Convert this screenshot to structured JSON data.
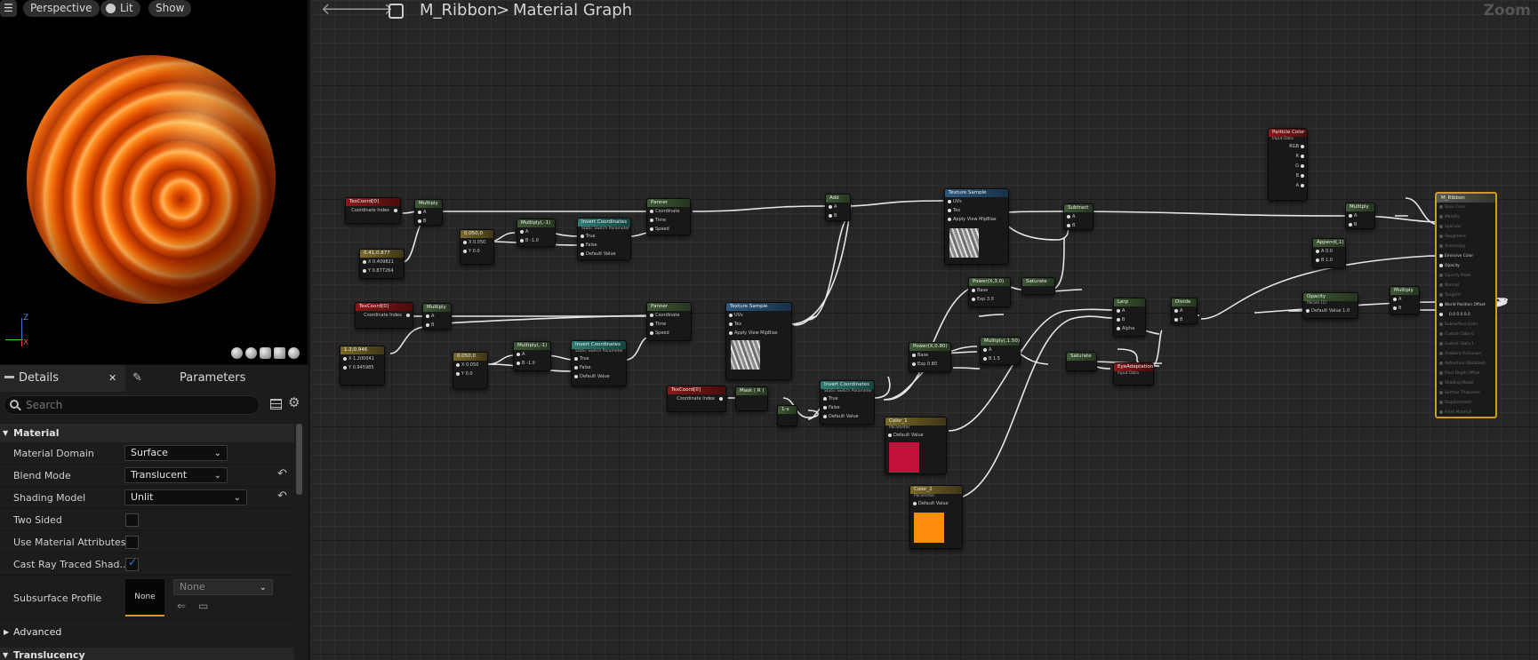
{
  "viewport": {
    "menu_label": "☰",
    "perspective_label": "Perspective",
    "lit_label": "Lit",
    "show_label": "Show",
    "axis_labels": {
      "x": "X",
      "z": "Z"
    }
  },
  "details": {
    "tab_details": "Details",
    "tab_parameters": "Parameters",
    "search_placeholder": "Search",
    "category_material": "Material",
    "rows": {
      "material_domain": {
        "label": "Material Domain",
        "value": "Surface"
      },
      "blend_mode": {
        "label": "Blend Mode",
        "value": "Translucent"
      },
      "shading_model": {
        "label": "Shading Model",
        "value": "Unlit"
      },
      "two_sided": {
        "label": "Two Sided",
        "checked": false
      },
      "use_material_attributes": {
        "label": "Use Material Attributes",
        "checked": false
      },
      "cast_ray_traced_shadows": {
        "label": "Cast Ray Traced Shad...",
        "checked": true
      },
      "subsurface_profile": {
        "label": "Subsurface Profile",
        "thumb": "None",
        "value": "None"
      }
    },
    "category_advanced": "Advanced",
    "category_translucency": "Translucency"
  },
  "graph": {
    "breadcrumb_asset": "M_Ribbon",
    "breadcrumb_sep": ">",
    "breadcrumb_page": "Material Graph",
    "zoom_label": "Zoom",
    "nodes": {
      "texcoord1": {
        "title": "TexCoord[0]",
        "pin": "Coordinate Index",
        "val": "0"
      },
      "multiply1": {
        "title": "Multiply"
      },
      "const2v_a": {
        "title": "0.41,0.877",
        "x": "X 0.409821",
        "y": "Y 0.877264"
      },
      "panner1": {
        "title": "Panner",
        "pins": [
          "Coordinate",
          "Time",
          "Speed"
        ]
      },
      "const_a": {
        "title": "0.050,0",
        "x": "X 0.050",
        "y": "Y 0.0"
      },
      "multiply_b": {
        "title": "Multiply(,-1)",
        "a": "A",
        "b": "B -1.0"
      },
      "invert_a": {
        "title": "Invert Coordinates",
        "sub": "Static Switch Parameter",
        "pins": [
          "True",
          "False",
          "Default Value"
        ]
      },
      "add1": {
        "title": "Add"
      },
      "texsample1": {
        "title": "Texture Sample",
        "pins": [
          "UVs",
          "Tex",
          "Apply View MipBias"
        ],
        "outs": [
          "RGB",
          "R",
          "G",
          "B",
          "A",
          "RGBA"
        ]
      },
      "subtract1": {
        "title": "Subtract"
      },
      "texcoord2": {
        "title": "TexCoord[0]",
        "pin": "Coordinate Index",
        "val": "0"
      },
      "multiply2": {
        "title": "Multiply"
      },
      "const2v_b": {
        "title": "1.2,0.946",
        "x": "X 1.200041",
        "y": "Y 0.945985"
      },
      "const_b": {
        "title": "0.050,0",
        "x": "X 0.050",
        "y": "Y 0.0"
      },
      "multiply_c": {
        "title": "Multiply(,-1)",
        "a": "A",
        "b": "B -1.0"
      },
      "invert_b": {
        "title": "Invert Coordinates",
        "sub": "Static Switch Parameter",
        "pins": [
          "True",
          "False",
          "Default Value"
        ]
      },
      "panner2": {
        "title": "Panner",
        "pins": [
          "Coordinate",
          "Time",
          "Speed"
        ]
      },
      "texsample2": {
        "title": "Texture Sample",
        "pins": [
          "UVs",
          "Tex",
          "Apply View MipBias"
        ],
        "outs": [
          "RGB",
          "R",
          "G",
          "B",
          "A",
          "RGBA"
        ]
      },
      "power1": {
        "title": "Power(X,3.0)",
        "base": "Base",
        "exp": "Exp 3.0"
      },
      "saturate1": {
        "title": "Saturate"
      },
      "multiply_d": {
        "title": "Multiply(,1.50)",
        "a": "A",
        "b": "B 1.5"
      },
      "texcoord3": {
        "title": "TexCoord[0]",
        "pin": "Coordinate Index",
        "val": "0"
      },
      "mask1": {
        "title": "Mask ( R )"
      },
      "oneminus1": {
        "title": "1-x"
      },
      "invert_c": {
        "title": "Invert Coordinates",
        "sub": "Static Switch Parameter",
        "pins": [
          "True",
          "False",
          "Default Value"
        ]
      },
      "power2": {
        "title": "Power(X,0.80)",
        "base": "Base",
        "exp": "Exp 0.80"
      },
      "color1": {
        "title": "Color_1",
        "sub": "Parameter",
        "pin": "Default Value"
      },
      "color2": {
        "title": "Color_2",
        "sub": "Parameter",
        "pin": "Default Value"
      },
      "saturate2": {
        "title": "Saturate"
      },
      "lerp1": {
        "title": "Lerp",
        "pins": [
          "A",
          "B",
          "Alpha"
        ]
      },
      "divide1": {
        "title": "Divide"
      },
      "eyeadapt": {
        "title": "EyeAdaptation",
        "sub": "Input Data"
      },
      "particlecolor": {
        "title": "Particle Color",
        "sub": "Input Data",
        "outs": [
          "RGB",
          "R",
          "G",
          "B",
          "A",
          "RGBA"
        ]
      },
      "multiply3": {
        "title": "Multiply"
      },
      "append1": {
        "title": "Append(,1)",
        "a": "A 0.0",
        "b": "B 1.0"
      },
      "opacity_param": {
        "title": "Opacity",
        "sub": "Param (1)",
        "pin": "Default Value 1.0"
      },
      "multiply4": {
        "title": "Multiply"
      }
    },
    "result": {
      "title": "M_Ribbon",
      "pins": [
        "Base Color",
        "Metallic",
        "Specular",
        "Roughness",
        "Anisotropy",
        "Emissive Color",
        "Opacity",
        "Opacity Mask",
        "Normal",
        "Tangent",
        "World Position Offset",
        "Subsurface Color",
        "Custom Data 0",
        "Custom Data 1",
        "Ambient Occlusion",
        "Refraction (Disabled)",
        "Pixel Depth Offset",
        "Shading Model",
        "Surface Thickness",
        "Displacement",
        "Front Material"
      ],
      "active": [
        5,
        6,
        10
      ],
      "wpo_values": "0.0   0.0   0.0"
    }
  },
  "colors": {
    "accent_checkbox": "#2a7de1",
    "color1_swatch": "#c21038",
    "color2_swatch": "#ff8c0a",
    "result_border": "#d49a1a"
  }
}
